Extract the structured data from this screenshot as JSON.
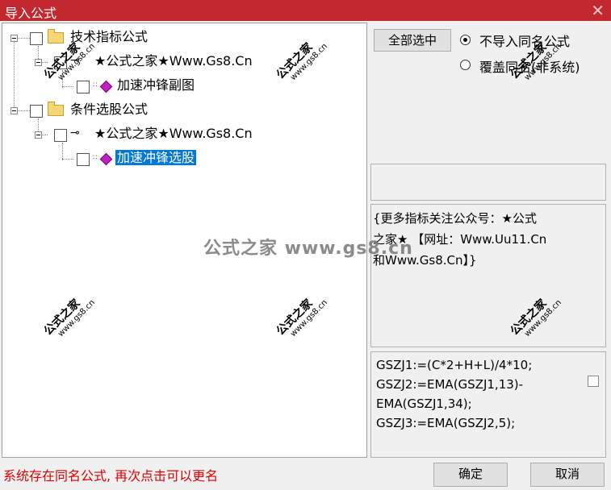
{
  "window": {
    "title": "导入公式",
    "close_glyph": "✕"
  },
  "tree": {
    "group1": {
      "label": "技术指标公式"
    },
    "group1_sub": {
      "label": "★公式之家★Www.Gs8.Cn"
    },
    "group1_leaf": {
      "label": "加速冲锋副图"
    },
    "group2": {
      "label": "条件选股公式"
    },
    "group2_sub": {
      "label": "★公式之家★Www.Gs8.Cn"
    },
    "group2_leaf": {
      "label": "加速冲锋选股"
    }
  },
  "options": {
    "select_all": "全部选中",
    "radio_skip": "不导入同名公式",
    "radio_overwrite": "覆盖同名(非系统)"
  },
  "description": {
    "line1": "{更多指标关注公众号：★公式",
    "line2": "之家★ 【网址：Www.Uu11.Cn",
    "line3": "和Www.Gs8.Cn】}"
  },
  "formula": {
    "lines": [
      "GSZJ1:=(C*2+H+L)/4*10;",
      "GSZJ2:=EMA(GSZJ1,13)-",
      "EMA(GSZJ1,34);",
      "GSZJ3:=EMA(GSZJ2,5);"
    ]
  },
  "footer": {
    "status": "系统存在同名公式, 再次点击可以更名",
    "ok": "确定",
    "cancel": "取消"
  },
  "watermark": {
    "text": "公式之家",
    "url": "www.gs8.cn",
    "center": "公式之家 www.gs8.cn"
  }
}
